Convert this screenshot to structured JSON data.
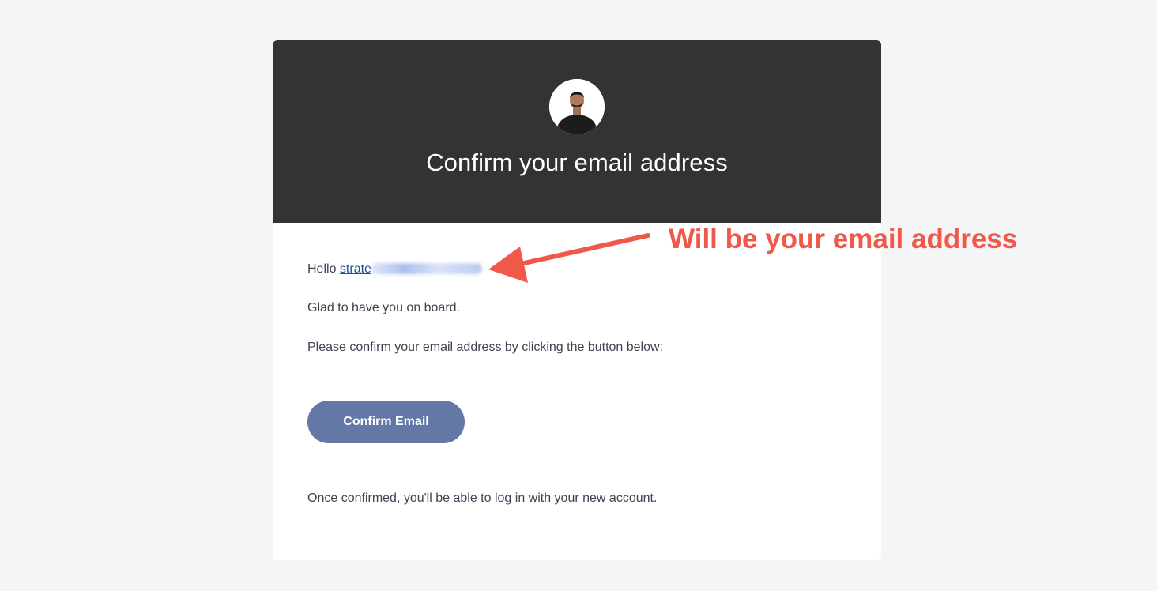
{
  "header": {
    "title": "Confirm your email address"
  },
  "body": {
    "greeting": "Hello",
    "email_visible_prefix": "strate",
    "line_glad": "Glad to have you on board.",
    "line_instruction": "Please confirm your email address by clicking the button below:",
    "confirm_button_label": "Confirm Email",
    "line_after": "Once confirmed, you'll be able to log in with your new account."
  },
  "annotation": {
    "text": "Will be your email address",
    "color": "#f0584a"
  },
  "colors": {
    "page_background": "#f4f5f7",
    "header_background": "#333333",
    "button_background": "#6478a6",
    "link": "#1f4f9b"
  },
  "icons": {
    "avatar": "profile-photo-icon",
    "arrow": "arrow-pointer-icon"
  }
}
